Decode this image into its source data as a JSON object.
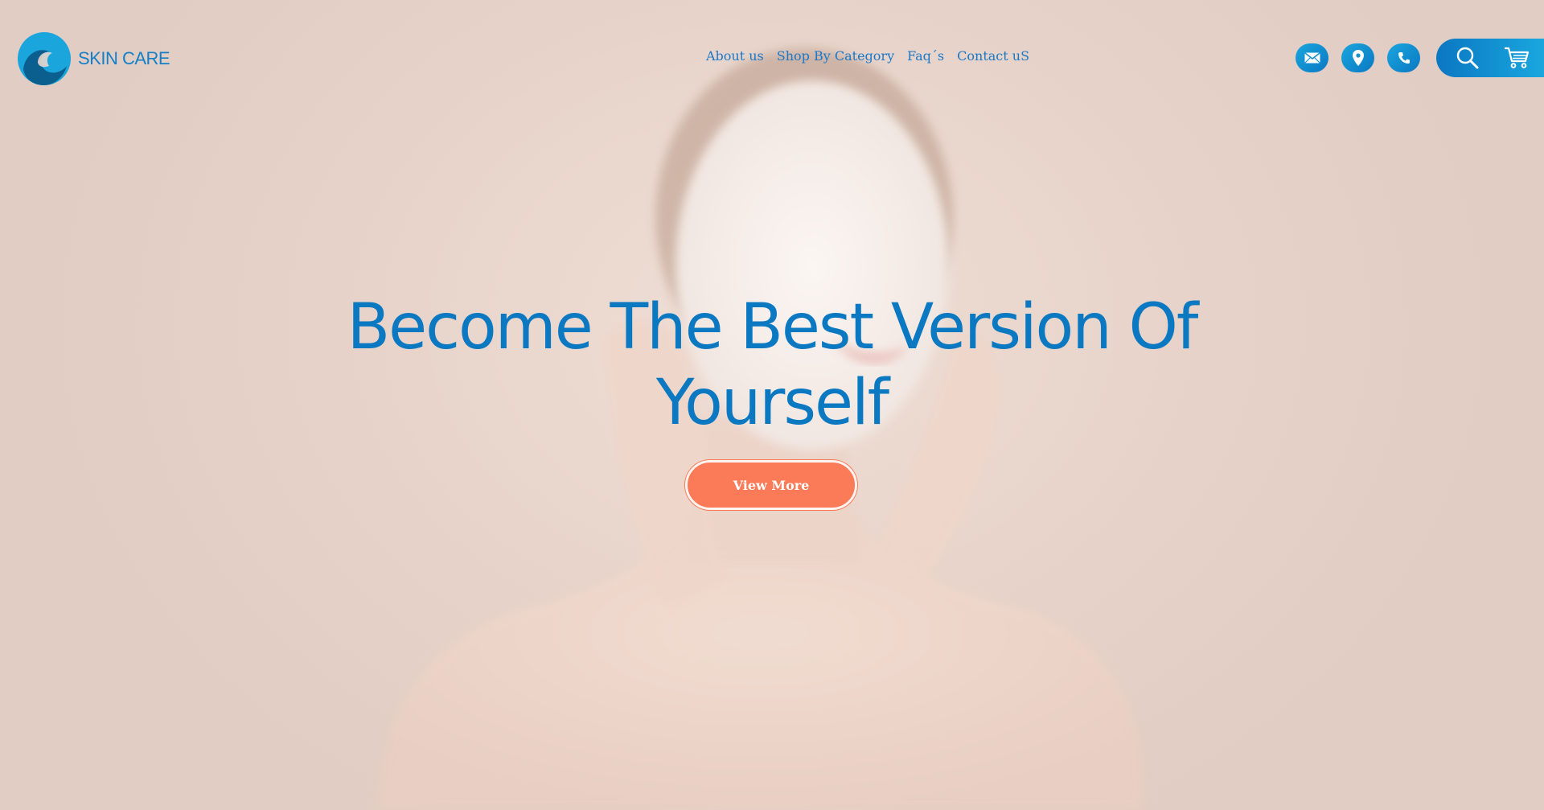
{
  "brand": {
    "name": "SKIN CARE",
    "logo_colors": [
      "#1aa6dc",
      "#0a6f9e"
    ]
  },
  "nav": {
    "items": [
      {
        "label": "About us"
      },
      {
        "label": "Shop By Category"
      },
      {
        "label": "Faq´s"
      },
      {
        "label": "Contact uS"
      }
    ]
  },
  "contact_icons": [
    "mail-icon",
    "location-pin-icon",
    "phone-icon"
  ],
  "tools": [
    "search-icon",
    "cart-icon"
  ],
  "hero": {
    "headline": "Become The Best Version Of Yourself",
    "cta_label": "View More"
  },
  "colors": {
    "accent_blue": "#0b78c2",
    "cta_orange": "#fb7a58",
    "background": "#e6d6cd"
  }
}
